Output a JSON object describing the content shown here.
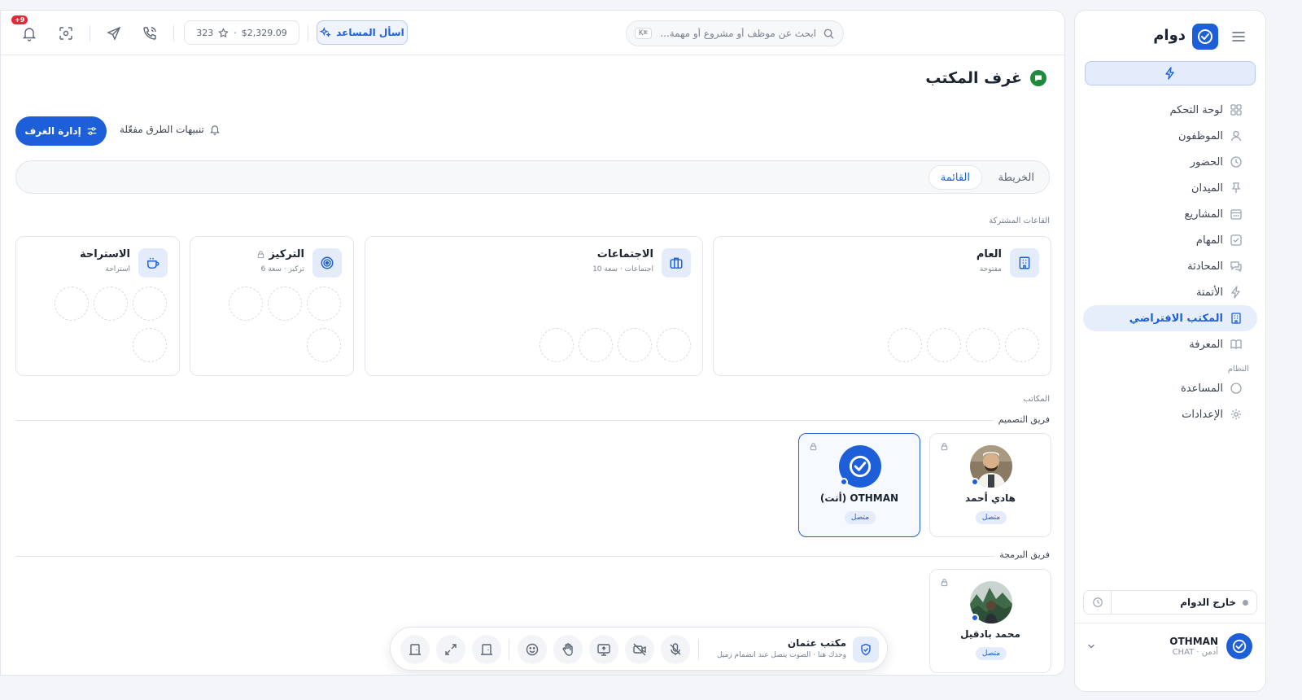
{
  "app": {
    "name": "دوام",
    "brand_color": "#1d5fd8"
  },
  "sidebar": {
    "items": [
      {
        "label": "لوحة التحكم",
        "icon": "grid-icon"
      },
      {
        "label": "الموظفون",
        "icon": "user-icon"
      },
      {
        "label": "الحضور",
        "icon": "clock-icon"
      },
      {
        "label": "الميدان",
        "icon": "pin-icon"
      },
      {
        "label": "المشاريع",
        "icon": "calendar-icon"
      },
      {
        "label": "المهام",
        "icon": "checkbox-icon"
      },
      {
        "label": "المحادثة",
        "icon": "chat-icon"
      },
      {
        "label": "الأتمتة",
        "icon": "bolt-icon"
      },
      {
        "label": "المكتب الافتراضي",
        "icon": "building-icon",
        "active": true
      },
      {
        "label": "المعرفة",
        "icon": "book-icon"
      }
    ],
    "system_label": "النظام",
    "system_items": [
      {
        "label": "المساعدة",
        "icon": "help-circle-icon"
      },
      {
        "label": "الإعدادات",
        "icon": "gear-icon"
      }
    ],
    "status": "خارج الدوام",
    "user": {
      "name": "OTHMAN",
      "role": "أدمن · CHAT"
    }
  },
  "topbar": {
    "search_placeholder": "ابحث عن موظف أو مشروع أو مهمة...",
    "search_shortcut": "⌘K",
    "ask_label": "اسأل المساعد",
    "balance": "$2,329.09",
    "points": "323",
    "notifications_badge": "+9"
  },
  "page": {
    "title": "غرف المكتب",
    "manage_label": "إدارة الغرف",
    "knock_label": "تنبيهات الطرق مفعّلة",
    "tabs": [
      {
        "label": "الخريطة"
      },
      {
        "label": "القائمة",
        "active": true
      }
    ]
  },
  "shared_rooms": {
    "label": "القاعات المشتركة",
    "rooms": [
      {
        "name": "العام",
        "sub": "مفتوحة"
      },
      {
        "name": "الاجتماعات",
        "sub": "اجتماعات · سعة 10"
      },
      {
        "name": "التركيز",
        "sub": "تركيز · سعة 6"
      },
      {
        "name": "الاستراحة",
        "sub": "استراحة"
      }
    ]
  },
  "offices": {
    "label": "المكاتب",
    "teams": [
      {
        "name": "فريق التصميم",
        "members": [
          {
            "name": "هادي أحمد",
            "status": "متصل"
          },
          {
            "name": "OTHMAN (أنت)",
            "status": "متصل"
          }
        ]
      },
      {
        "name": "فريق البرمجة",
        "members": [
          {
            "name": "محمد بادقيل",
            "status": "متصل"
          }
        ]
      }
    ]
  },
  "dock": {
    "title": "مكتب عثمان",
    "sub": "وحدك هنا · الصوت يتصل عند انضمام زميل"
  }
}
